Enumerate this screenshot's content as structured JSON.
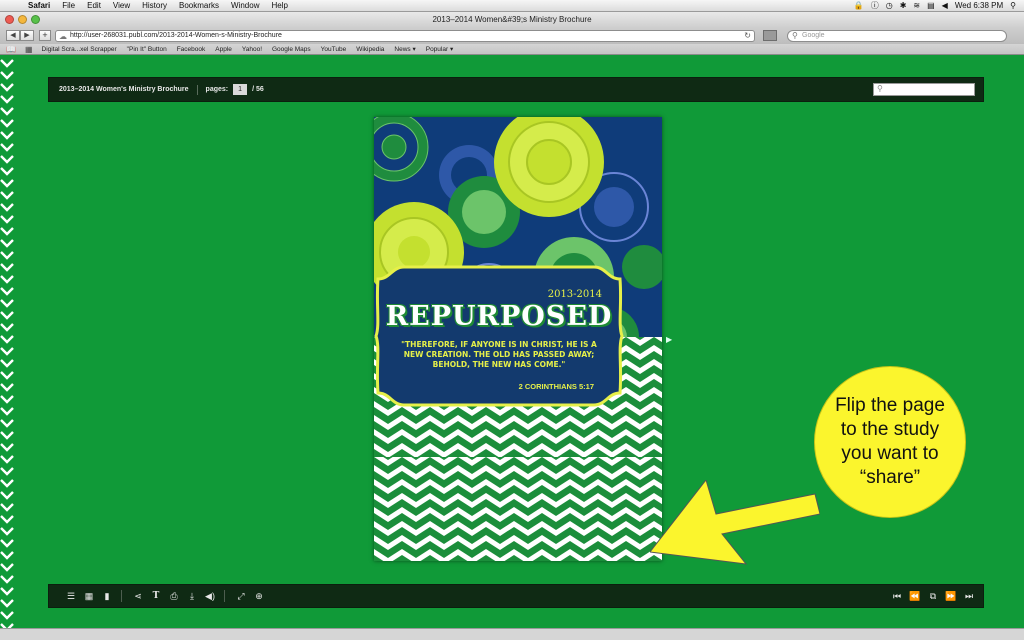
{
  "menubar": {
    "apple": "",
    "items": [
      "Safari",
      "File",
      "Edit",
      "View",
      "History",
      "Bookmarks",
      "Window",
      "Help"
    ],
    "clock": "Wed 6:38 PM"
  },
  "window": {
    "title": "2013–2014 Women&#39;s Ministry Brochure",
    "url": "http://user-268031.publ.com/2013-2014-Women-s-Ministry-Brochure",
    "search_placeholder": "Google"
  },
  "bookmarks": [
    "Digital Scra...xel Scrapper",
    "\"Pin It\" Button",
    "Facebook",
    "Apple",
    "Yahoo!",
    "Google Maps",
    "YouTube",
    "Wikipedia",
    "News ▾",
    "Popular ▾"
  ],
  "viewer": {
    "doc_title": "2013–2014 Women's Ministry Brochure",
    "pages_label": "pages:",
    "current_page": "1",
    "total_pages": "/ 56"
  },
  "brochure": {
    "year": "2013-2014",
    "headline": "REPURPOSED",
    "verse": "\"Therefore, if anyone is in Christ, he is a new creation. The old has passed away; behold, the new has come.\"",
    "reference": "2 CORINTHIANS 5:17"
  },
  "callout": {
    "text": "Flip the page to the study you want to “share”"
  },
  "colors": {
    "background": "#109a38",
    "viewer_bar": "#0f2a14",
    "callout": "#fbf52d",
    "navy": "#133a6e",
    "lime": "#c4e02f"
  },
  "toolbar_left": [
    "list-icon",
    "grid-icon",
    "bookmark-icon",
    "share-icon",
    "text-icon",
    "print-icon",
    "download-icon",
    "sound-icon",
    "fullscreen-icon",
    "zoom-icon"
  ],
  "toolbar_right": [
    "first-page-icon",
    "previous-page-icon",
    "spread-view-icon",
    "next-page-icon",
    "last-page-icon"
  ]
}
